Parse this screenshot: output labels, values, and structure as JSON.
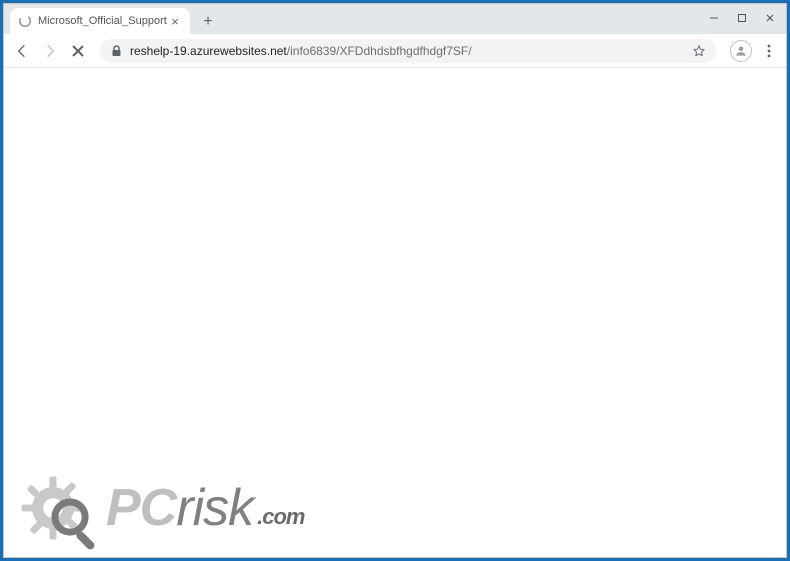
{
  "tab": {
    "title": "Microsoft_Official_Support"
  },
  "window_controls": {
    "minimize": "—",
    "maximize": "▢",
    "close": "✕"
  },
  "toolbar": {
    "newtab": "+"
  },
  "url": {
    "domain": "reshelp-19.azurewebsites.net",
    "path": "/info6839/XFDdhdsbfhgdfhdgf7SF/"
  },
  "watermark": {
    "pc": "PC",
    "risk": "risk",
    "dotcom": ".com"
  }
}
